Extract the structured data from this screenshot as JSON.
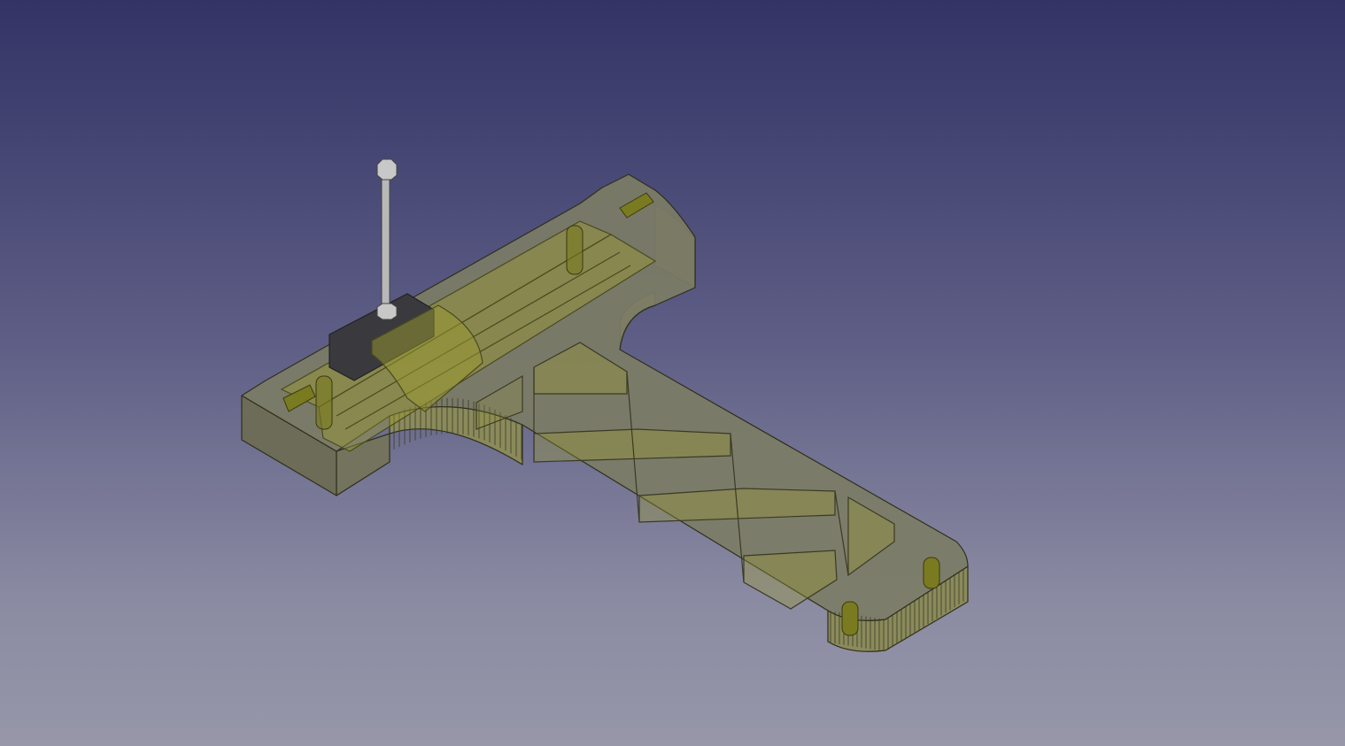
{
  "viewport": {
    "background_top": "#333366",
    "background_bottom": "#9797a9",
    "model": {
      "body_color": "#7c7c66",
      "edge_color": "#2f2f1c",
      "feature_color": "#9a9a30",
      "rod_color": "#b8b8b8",
      "clamp_color": "#3a3a3e"
    }
  }
}
